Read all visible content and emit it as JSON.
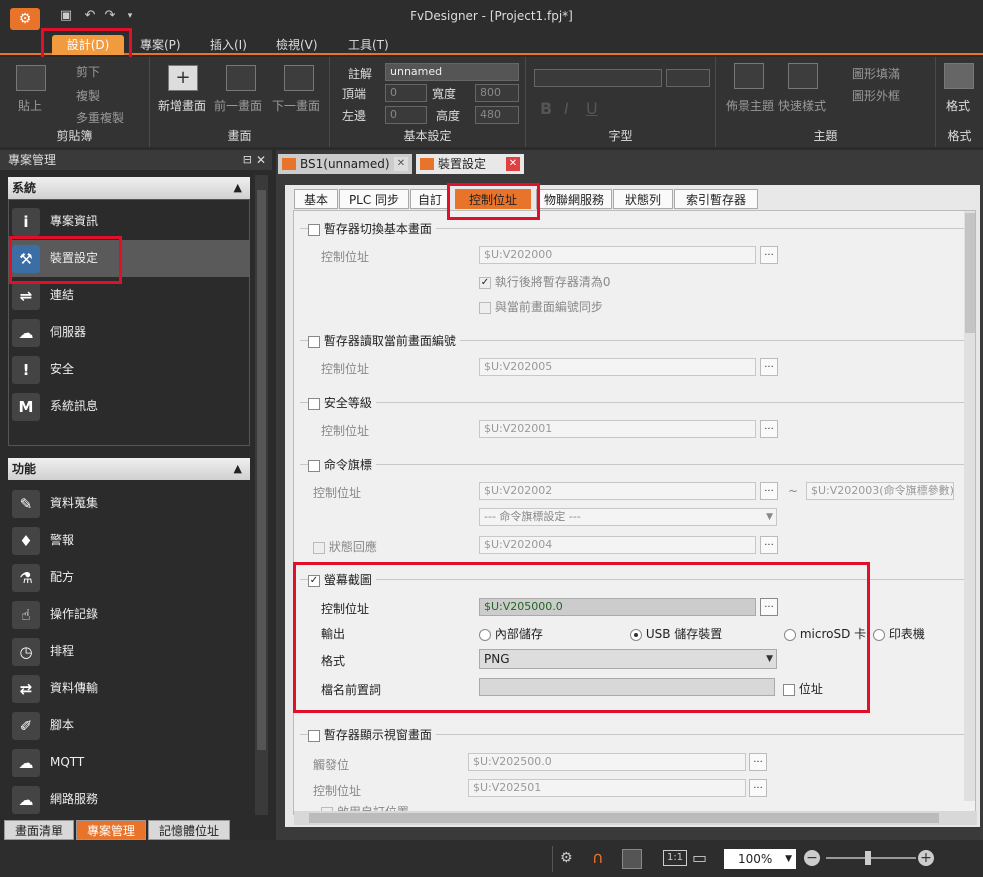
{
  "window": {
    "title": "FvDesigner - [Project1.fpj*]"
  },
  "menu": {
    "tabs": [
      "設計(D)",
      "專案(P)",
      "插入(I)",
      "檢視(V)",
      "工具(T)"
    ]
  },
  "ribbon": {
    "clipboard": {
      "label": "剪貼簿",
      "paste": "貼上",
      "cut": "剪下",
      "copy": "複製",
      "multi_copy": "多重複製"
    },
    "screen": {
      "label": "畫面",
      "new": "新增畫面",
      "prev": "前一畫面",
      "next": "下一畫面"
    },
    "basic": {
      "label": "基本設定",
      "note_label": "註解",
      "note_value": "unnamed",
      "top_label": "頂端",
      "top_value": "0",
      "width_label": "寬度",
      "width_value": "800",
      "left_label": "左邊",
      "left_value": "0",
      "height_label": "高度",
      "height_value": "480"
    },
    "font": {
      "label": "字型",
      "bold": "B",
      "italic": "I",
      "underline": "U"
    },
    "theme": {
      "label": "主題",
      "layout": "佈景主題",
      "quick": "快速樣式",
      "fill": "圖形填滿",
      "outline": "圖形外框"
    },
    "format": {
      "label": "格式",
      "btn": "格式"
    }
  },
  "sidebar": {
    "title": "專案管理",
    "system_header": "系統",
    "system_items": [
      {
        "label": "專案資訊",
        "icon": "i"
      },
      {
        "label": "裝置設定",
        "icon": "⚒"
      },
      {
        "label": "連結",
        "icon": "⇌"
      },
      {
        "label": "伺服器",
        "icon": "☁"
      },
      {
        "label": "安全",
        "icon": "!"
      },
      {
        "label": "系統訊息",
        "icon": "M"
      }
    ],
    "function_header": "功能",
    "function_items": [
      {
        "label": "資料蒐集",
        "icon": "✎"
      },
      {
        "label": "警報",
        "icon": "♦"
      },
      {
        "label": "配方",
        "icon": "⚗"
      },
      {
        "label": "操作記錄",
        "icon": "☝"
      },
      {
        "label": "排程",
        "icon": "◷"
      },
      {
        "label": "資料傳輸",
        "icon": "⇄"
      },
      {
        "label": "腳本",
        "icon": "✐"
      },
      {
        "label": "MQTT",
        "icon": "☁"
      },
      {
        "label": "網路服務",
        "icon": "☁"
      }
    ],
    "bottom_tabs": [
      "畫面清單",
      "專案管理",
      "記憶體位址"
    ]
  },
  "doc_tabs": [
    "BS1(unnamed)",
    "裝置設定"
  ],
  "panel": {
    "tabs": [
      "基本",
      "PLC 同步",
      "自訂",
      "控制位址",
      "物聯網服務",
      "狀態列",
      "索引暫存器"
    ],
    "g1": {
      "title": "暫存器切換基本畫面",
      "addr_label": "控制位址",
      "addr": "$U:V202000",
      "opt1": "執行後將暫存器清為0",
      "opt2": "與當前畫面編號同步"
    },
    "g2": {
      "title": "暫存器讀取當前畫面編號",
      "addr_label": "控制位址",
      "addr": "$U:V202005"
    },
    "g3": {
      "title": "安全等級",
      "addr_label": "控制位址",
      "addr": "$U:V202001"
    },
    "g4": {
      "title": "命令旗標",
      "addr_label": "控制位址",
      "addr": "$U:V202002",
      "addr2": "$U:V202003(命令旗標參數)",
      "select": "---  命令旗標設定  ---",
      "status_label": "狀態回應",
      "status_addr": "$U:V202004",
      "tilde": "~"
    },
    "g5": {
      "title": "螢幕截圖",
      "addr_label": "控制位址",
      "addr": "$U:V205000.0",
      "output_label": "輸出",
      "out1": "內部儲存",
      "out2": "USB 儲存裝置",
      "out3": "microSD 卡",
      "out4": "印表機",
      "format_label": "格式",
      "format": "PNG",
      "prefix_label": "檔名前置詞",
      "addr_cb": "位址"
    },
    "g6": {
      "title": "暫存器顯示視窗畫面",
      "trigger_label": "觸發位",
      "trigger": "$U:V202500.0",
      "addr_label": "控制位址",
      "addr": "$U:V202501",
      "partial": "啟用自訂位置"
    },
    "browse": "..."
  },
  "status": {
    "zoom": "100%",
    "ratio": "1:1"
  }
}
